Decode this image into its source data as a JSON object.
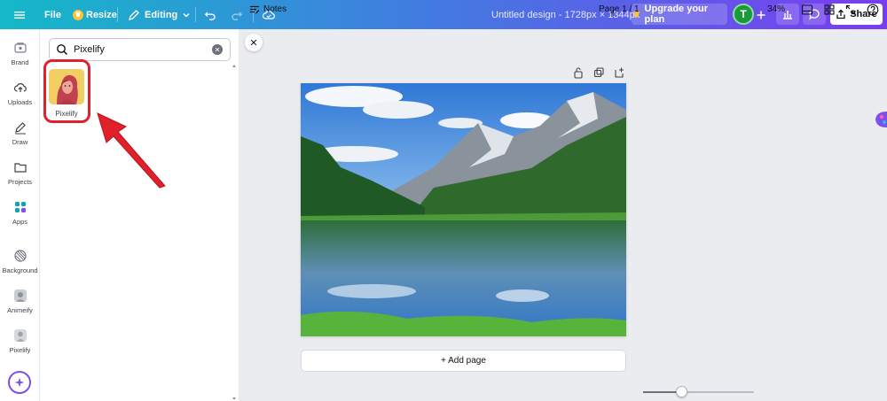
{
  "topbar": {
    "file_label": "File",
    "resize_label": "Resize",
    "editing_label": "Editing",
    "document_title": "Untitled design - 1728px × 1344px",
    "upgrade_label": "Upgrade your plan",
    "avatar_initial": "T",
    "share_label": "Share"
  },
  "rail": {
    "items": [
      {
        "label": "Brand",
        "icon": "brand-icon"
      },
      {
        "label": "Uploads",
        "icon": "cloud-upload-icon"
      },
      {
        "label": "Draw",
        "icon": "pen-icon"
      },
      {
        "label": "Projects",
        "icon": "folder-icon"
      },
      {
        "label": "Apps",
        "icon": "apps-icon"
      },
      {
        "label": "Background",
        "icon": "background-pattern-icon"
      },
      {
        "label": "Animeify",
        "icon": "animeify-thumb"
      },
      {
        "label": "Pixelify",
        "icon": "pixelify-thumb"
      }
    ]
  },
  "panel": {
    "search_value": "Pixelify",
    "result_label": "Pixelify"
  },
  "canvas": {
    "add_page_label": "+ Add page"
  },
  "bottombar": {
    "notes_label": "Notes",
    "page_indicator": "Page 1 / 1",
    "zoom_label": "34%",
    "zoom_fraction": 0.34
  },
  "colors": {
    "accent_purple": "#7d4ff0",
    "highlight_red": "#e0202a",
    "avatar_green": "#1b9a3c"
  }
}
